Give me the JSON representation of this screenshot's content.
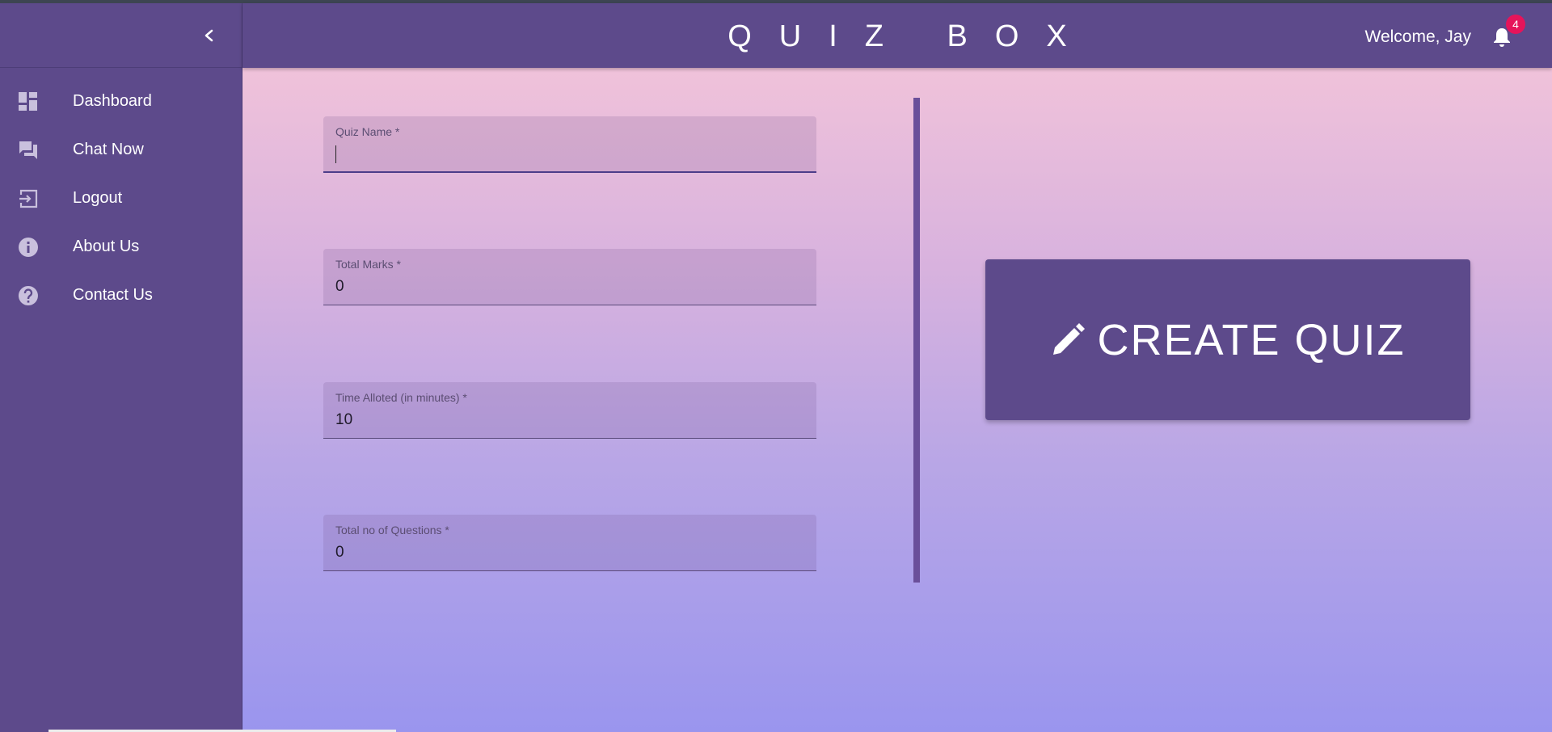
{
  "header": {
    "app_title": "QUIZ BOX",
    "welcome_text": "Welcome, Jay",
    "notification_count": "4"
  },
  "sidebar": {
    "items": [
      {
        "label": "Dashboard",
        "icon": "dashboard-icon"
      },
      {
        "label": "Chat Now",
        "icon": "chat-icon"
      },
      {
        "label": "Logout",
        "icon": "logout-icon"
      },
      {
        "label": "About Us",
        "icon": "info-icon"
      },
      {
        "label": "Contact Us",
        "icon": "help-icon"
      }
    ]
  },
  "form": {
    "quiz_name": {
      "label": "Quiz Name *",
      "value": ""
    },
    "total_marks": {
      "label": "Total Marks *",
      "value": "0"
    },
    "time_alloted": {
      "label": "Time Alloted (in minutes) *",
      "value": "10"
    },
    "total_questions": {
      "label": "Total no of Questions *",
      "value": "0"
    }
  },
  "create_button": {
    "label": "CREATE QUIZ"
  },
  "colors": {
    "primary": "#5d4a8b",
    "badge": "#e6145a",
    "gradient_top": "#f0c2da",
    "gradient_bottom": "#9a95ee"
  }
}
